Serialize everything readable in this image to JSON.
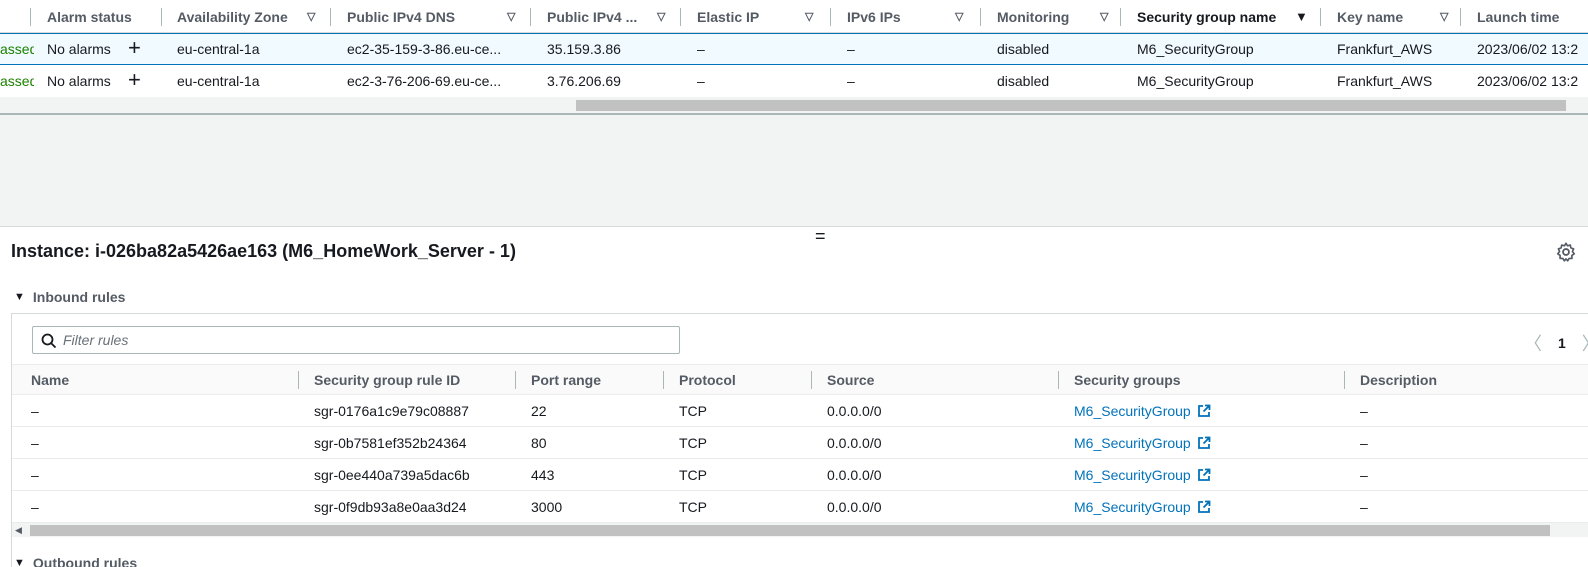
{
  "instances_table": {
    "columns": [
      {
        "label": "Alarm status"
      },
      {
        "label": "Availability Zone"
      },
      {
        "label": "Public IPv4 DNS"
      },
      {
        "label": "Public IPv4 ..."
      },
      {
        "label": "Elastic IP"
      },
      {
        "label": "IPv6 IPs"
      },
      {
        "label": "Monitoring"
      },
      {
        "label": "Security group name"
      },
      {
        "label": "Key name"
      },
      {
        "label": "Launch time"
      }
    ],
    "rows": [
      {
        "status_check": "assed",
        "alarm_status": "No alarms",
        "availability_zone": "eu-central-1a",
        "public_dns": "ec2-35-159-3-86.eu-ce...",
        "public_ipv4": "35.159.3.86",
        "elastic_ip": "–",
        "ipv6_ips": "–",
        "monitoring": "disabled",
        "security_group_name": "M6_SecurityGroup",
        "key_name": "Frankfurt_AWS",
        "launch_time": "2023/06/02 13:2"
      },
      {
        "status_check": "assed",
        "alarm_status": "No alarms",
        "availability_zone": "eu-central-1a",
        "public_dns": "ec2-3-76-206-69.eu-ce...",
        "public_ipv4": "3.76.206.69",
        "elastic_ip": "–",
        "ipv6_ips": "–",
        "monitoring": "disabled",
        "security_group_name": "M6_SecurityGroup",
        "key_name": "Frankfurt_AWS",
        "launch_time": "2023/06/02 13:2"
      }
    ]
  },
  "details_panel": {
    "title": "Instance: i-026ba82a5426ae163 (M6_HomeWork_Server - 1)",
    "inbound_section_label": "Inbound rules",
    "outbound_section_label": "Outbound rules",
    "filter_placeholder": "Filter rules",
    "page_number": "1",
    "rules_columns": [
      {
        "label": "Name"
      },
      {
        "label": "Security group rule ID"
      },
      {
        "label": "Port range"
      },
      {
        "label": "Protocol"
      },
      {
        "label": "Source"
      },
      {
        "label": "Security groups"
      },
      {
        "label": "Description"
      }
    ],
    "rules": [
      {
        "name": "–",
        "rule_id": "sgr-0176a1c9e79c08887",
        "port_range": "22",
        "protocol": "TCP",
        "source": "0.0.0.0/0",
        "security_group": "M6_SecurityGroup",
        "description": "–"
      },
      {
        "name": "–",
        "rule_id": "sgr-0b7581ef352b24364",
        "port_range": "80",
        "protocol": "TCP",
        "source": "0.0.0.0/0",
        "security_group": "M6_SecurityGroup",
        "description": "–"
      },
      {
        "name": "–",
        "rule_id": "sgr-0ee440a739a5dac6b",
        "port_range": "443",
        "protocol": "TCP",
        "source": "0.0.0.0/0",
        "security_group": "M6_SecurityGroup",
        "description": "–"
      },
      {
        "name": "–",
        "rule_id": "sgr-0f9db93a8e0aa3d24",
        "port_range": "3000",
        "protocol": "TCP",
        "source": "0.0.0.0/0",
        "security_group": "M6_SecurityGroup",
        "description": "–"
      }
    ]
  },
  "colors": {
    "link": "#0073bb",
    "status_green": "#1d8102",
    "selected_row_bg": "#f1faff",
    "header_text": "#545b64"
  },
  "icons": {
    "sort": "sort-caret-icon",
    "add": "plus-icon",
    "settings": "gear-icon",
    "search": "search-icon",
    "external": "external-link-icon",
    "collapse": "caret-down-icon",
    "drag": "drag-handle-icon"
  }
}
